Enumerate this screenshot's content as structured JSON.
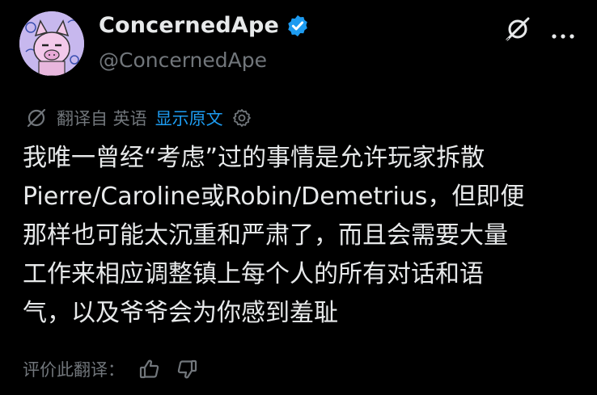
{
  "author": {
    "display_name": "ConcernedApe",
    "handle": "@ConcernedApe"
  },
  "translation_bar": {
    "source_label": "翻译自 英语",
    "show_original_label": "显示原文"
  },
  "tweet": {
    "lines": [
      "我唯一曾经“考虑”过的事情是允许玩家拆散",
      "Pierre/Caroline或Robin/Demetrius，但即便",
      "那样也可能太沉重和严肃了，而且会需要大量",
      "工作来相应调整镇上每个人的所有对话和语",
      "气，以及爷爷会为你感到羞耻"
    ]
  },
  "rating": {
    "label": "评价此翻译："
  },
  "colors": {
    "background": "#000000",
    "text": "#e7e9ea",
    "secondary": "#71767b",
    "accent": "#1d9bf0",
    "avatar_bg": "#c7b8ee"
  },
  "icons": [
    "verified-badge-icon",
    "grok-icon",
    "more-icon",
    "translate-icon",
    "settings-gear-icon",
    "thumbs-up-icon",
    "thumbs-down-icon"
  ]
}
